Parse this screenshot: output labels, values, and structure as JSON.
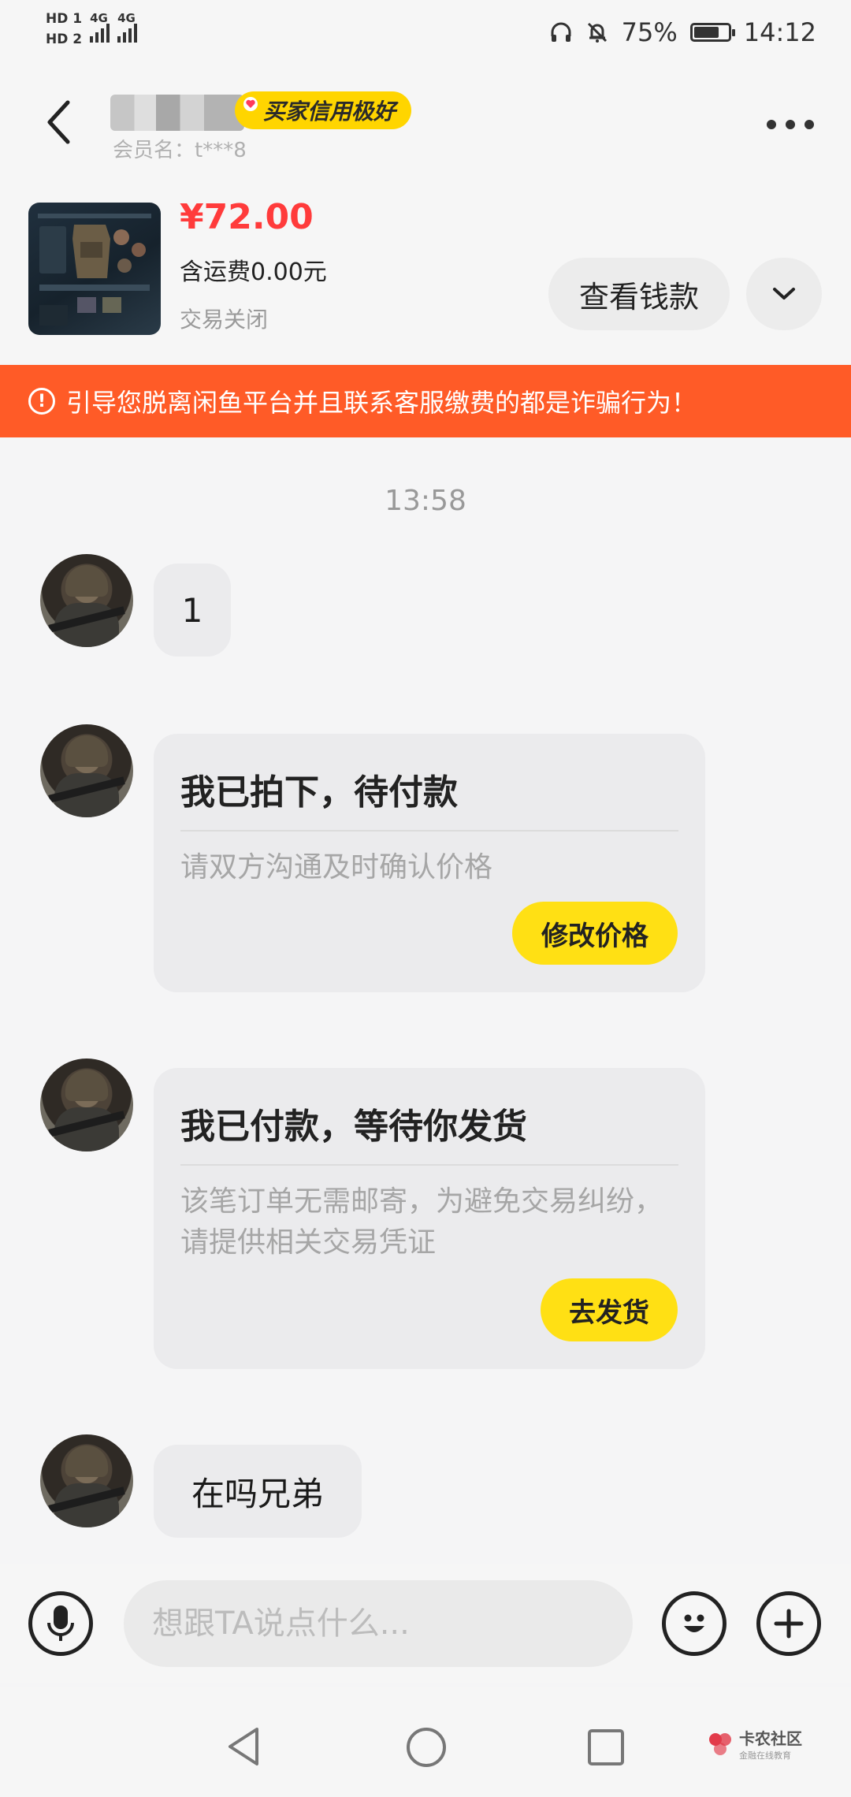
{
  "status_bar": {
    "hd1": "HD 1",
    "hd2": "HD 2",
    "net1": "4G",
    "net2": "4G",
    "battery_percent": "75%",
    "battery_level": 0.75,
    "time": "14:12",
    "icons": [
      "headphones-icon",
      "bell-off-icon",
      "battery-icon"
    ]
  },
  "header": {
    "credit_badge": "买家信用极好",
    "member_name": "会员名：t***8"
  },
  "product": {
    "price": "¥72.00",
    "shipping": "含运费0.00元",
    "status": "交易关闭",
    "view_money_label": "查看钱款"
  },
  "warning": {
    "icon": "!",
    "text": "引导您脱离闲鱼平台并且联系客服缴费的都是诈骗行为！"
  },
  "chat": {
    "timestamp": "13:58",
    "messages": [
      {
        "type": "text",
        "text": "1"
      },
      {
        "type": "card",
        "title": "我已拍下，待付款",
        "desc": "请双方沟通及时确认价格",
        "button": "修改价格"
      },
      {
        "type": "card",
        "title": "我已付款，等待你发货",
        "desc": "该笔订单无需邮寄，为避免交易纠纷，请提供相关交易凭证",
        "button": "去发货"
      },
      {
        "type": "text",
        "text": "在吗兄弟"
      }
    ]
  },
  "input_bar": {
    "placeholder": "想跟TA说点什么..."
  },
  "watermark": {
    "main": "卡农社区",
    "sub": "金融在线教育"
  },
  "colors": {
    "price": "#ff3b3b",
    "warning_bg": "#ff5b27",
    "badge": "#ffd500",
    "action_button": "#ffe014"
  }
}
